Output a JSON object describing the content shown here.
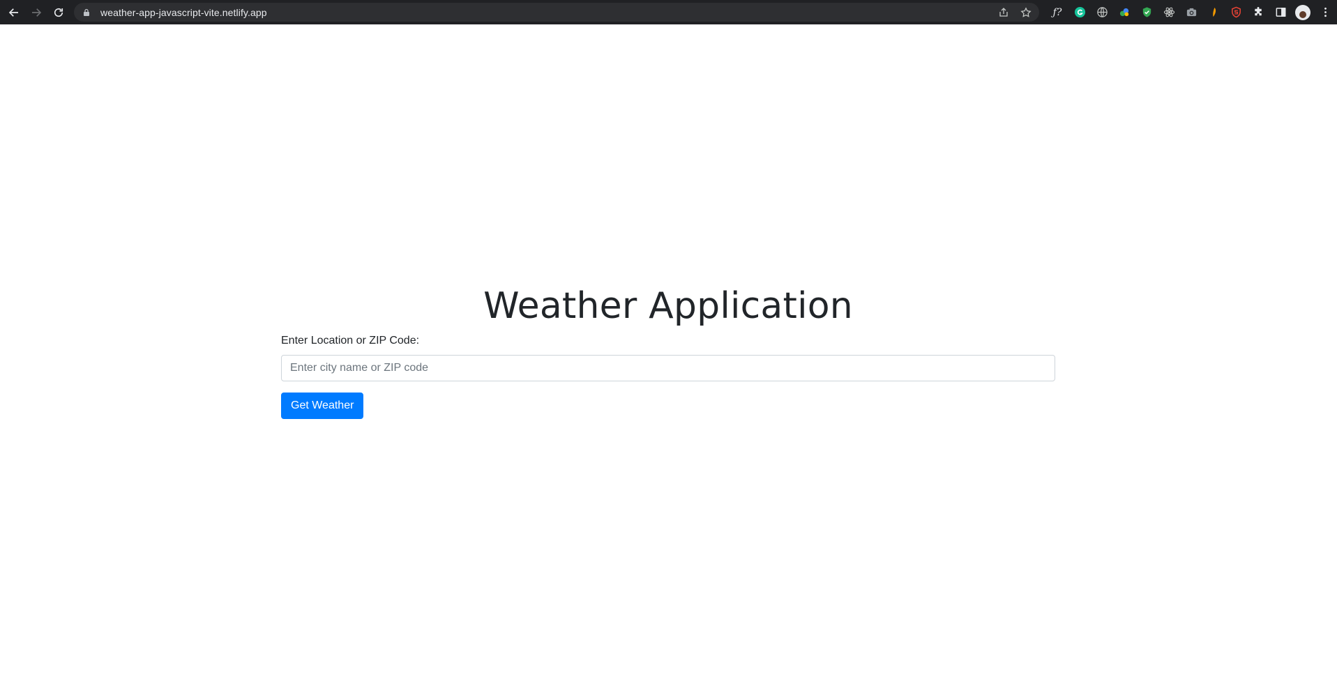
{
  "browser": {
    "url": "weather-app-javascript-vite.netlify.app",
    "nav": {
      "back": "back-icon",
      "forward": "forward-icon",
      "reload": "reload-icon"
    },
    "omnibox_icons": [
      "share-icon",
      "bookmark-star-icon"
    ],
    "extensions": [
      "font-identifier-icon",
      "grammarly-icon",
      "globe-icon",
      "color-extension-icon",
      "shield-check-icon",
      "react-devtools-icon",
      "camera-icon",
      "leaf-icon",
      "shield-red-icon",
      "puzzle-extensions-icon",
      "side-panel-icon",
      "profile-avatar",
      "more-menu-icon"
    ]
  },
  "app": {
    "title": "Weather Application",
    "location_label": "Enter Location or ZIP Code:",
    "location_placeholder": "Enter city name or ZIP code",
    "location_value": "",
    "submit_label": "Get Weather"
  },
  "colors": {
    "chrome_bg": "#202124",
    "omnibox_bg": "#2e2f32",
    "primary": "#007bff",
    "text": "#212529",
    "input_border": "#ced4da"
  }
}
